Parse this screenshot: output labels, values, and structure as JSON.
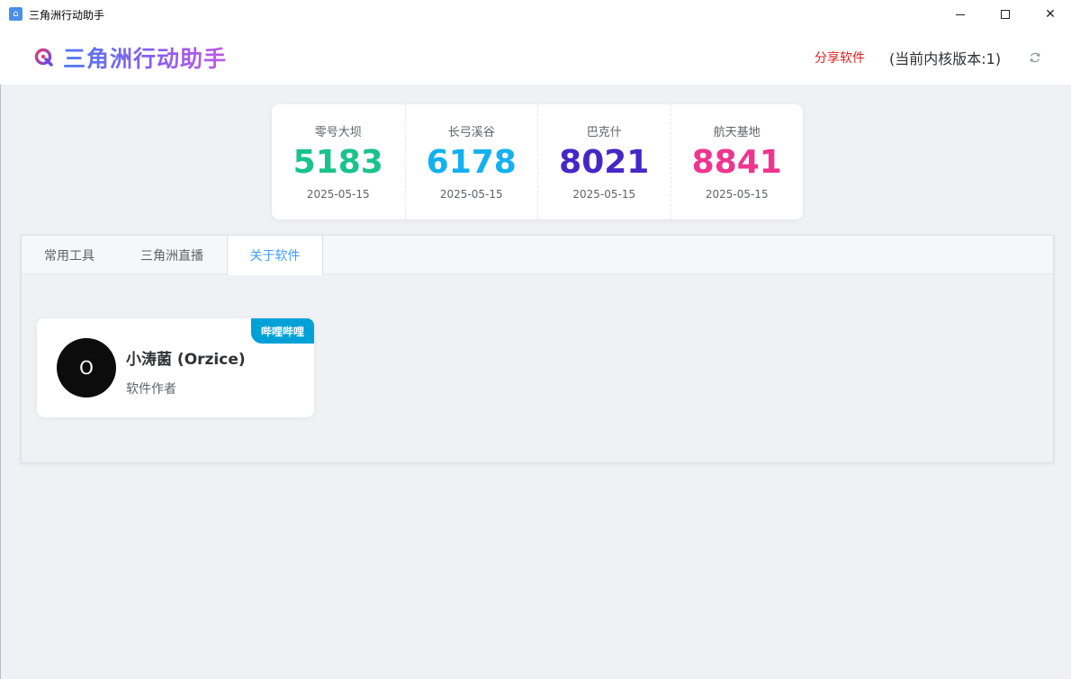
{
  "window": {
    "title": "三角洲行动助手",
    "icon_name": "app-icon"
  },
  "header": {
    "brand": "三角洲行动助手",
    "share_label": "分享软件",
    "version_label": "(当前内核版本:1)"
  },
  "stats": [
    {
      "label": "零号大坝",
      "value": "5183",
      "date": "2025-05-15",
      "color": "#19c38a"
    },
    {
      "label": "长弓溪谷",
      "value": "6178",
      "date": "2025-05-15",
      "color": "#13b1f0"
    },
    {
      "label": "巴克什",
      "value": "8021",
      "date": "2025-05-15",
      "color": "#4428c8"
    },
    {
      "label": "航天基地",
      "value": "8841",
      "date": "2025-05-15",
      "color": "#f0358f"
    }
  ],
  "tabs": [
    {
      "label": "常用工具",
      "active": false
    },
    {
      "label": "三角洲直播",
      "active": false
    },
    {
      "label": "关于软件",
      "active": true
    }
  ],
  "author": {
    "avatar_letter": "O",
    "name": "小涛菌 (Orzice)",
    "role": "软件作者",
    "badge": "哔哩哔哩"
  },
  "colors": {
    "accent": "#409eff",
    "share": "#e02020",
    "badge": "#00a1d6"
  }
}
